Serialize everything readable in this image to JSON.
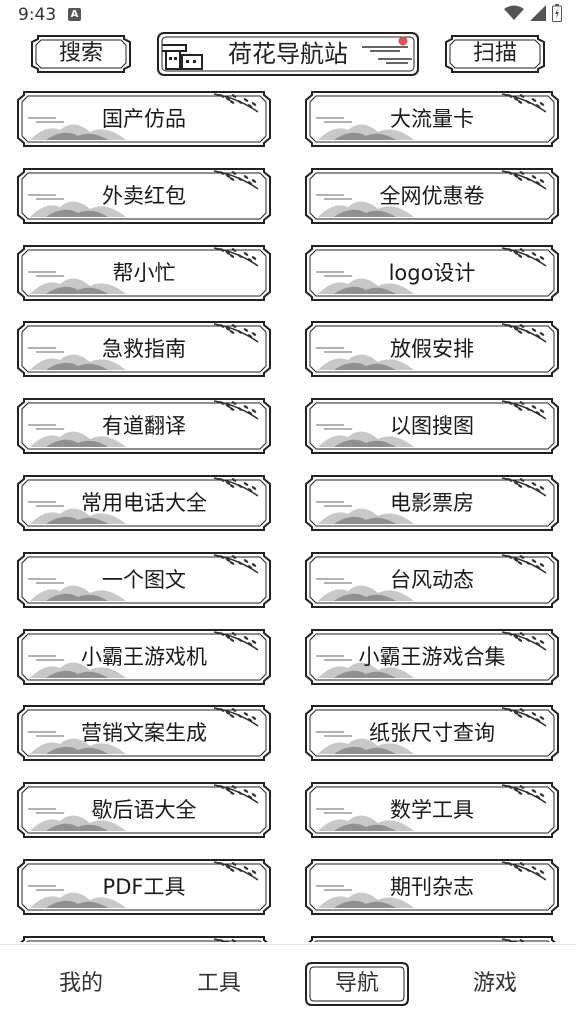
{
  "status": {
    "time": "9:43",
    "notif_letter": "A"
  },
  "header": {
    "search_label": "搜索",
    "title": "荷花导航站",
    "scan_label": "扫描"
  },
  "items": [
    "国产仿品",
    "大流量卡",
    "外卖红包",
    "全网优惠卷",
    "帮小忙",
    "logo设计",
    "急救指南",
    "放假安排",
    "有道翻译",
    "以图搜图",
    "常用电话大全",
    "电影票房",
    "一个图文",
    "台风动态",
    "小霸王游戏机",
    "小霸王游戏合集",
    "营销文案生成",
    "纸张尺寸查询",
    "歇后语大全",
    "数学工具",
    "PDF工具",
    "期刊杂志",
    "",
    ""
  ],
  "tabs": [
    "我的",
    "工具",
    "导航",
    "游戏"
  ],
  "active_tab": 2
}
